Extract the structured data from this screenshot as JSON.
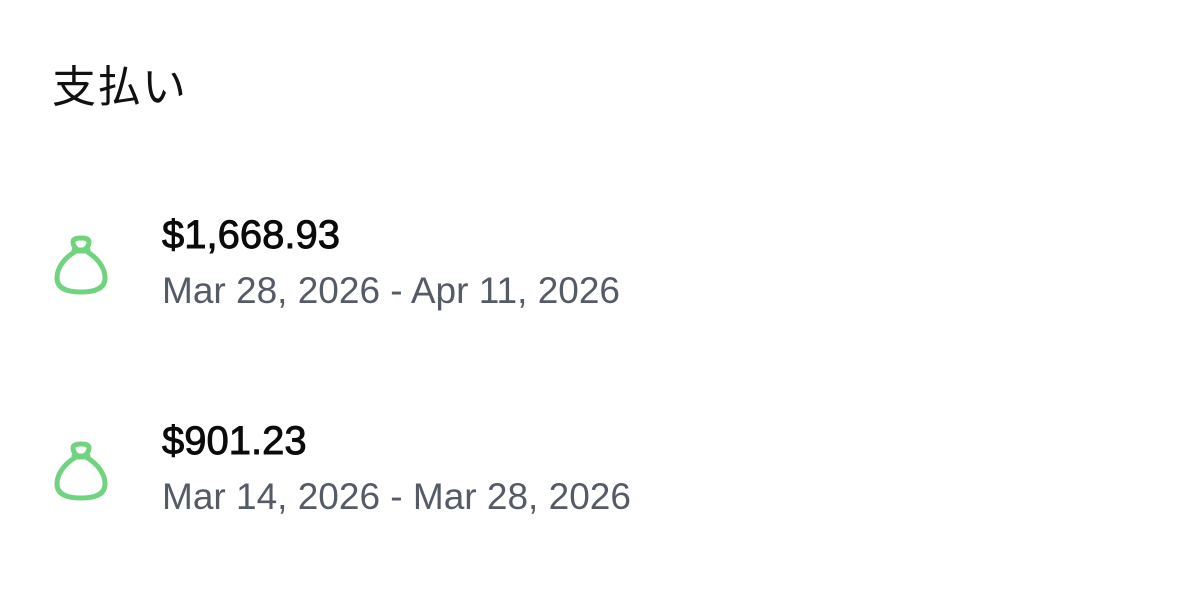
{
  "header": {
    "title": "支払い"
  },
  "colors": {
    "icon_green": "#6fd37f",
    "amount_text": "#0b0b0b",
    "date_text": "#545b66",
    "background": "#ffffff"
  },
  "payouts": [
    {
      "icon": "money-bag-icon",
      "amount": "$1,668.93",
      "date_range": "Mar 28, 2026 - Apr 11, 2026"
    },
    {
      "icon": "money-bag-icon",
      "amount": "$901.23",
      "date_range": "Mar 14, 2026 - Mar 28, 2026"
    }
  ]
}
